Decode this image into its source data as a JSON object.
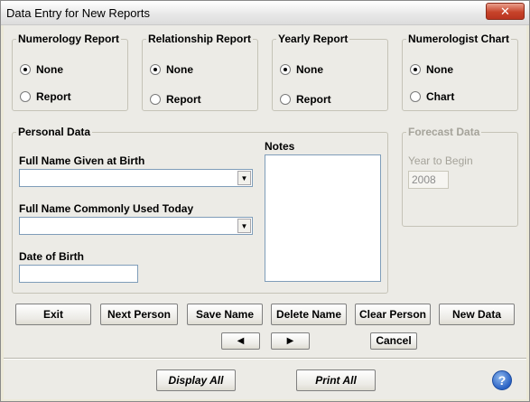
{
  "window": {
    "title": "Data Entry for New Reports",
    "close_glyph": "✕"
  },
  "numerology_report": {
    "label": "Numerology Report",
    "options": [
      "None",
      "Report"
    ],
    "selected": "None"
  },
  "relationship_report": {
    "label": "Relationship Report",
    "options": [
      "None",
      "Report"
    ],
    "selected": "None"
  },
  "yearly_report": {
    "label": "Yearly Report",
    "options": [
      "None",
      "Report"
    ],
    "selected": "None"
  },
  "numerologist_chart": {
    "label": "Numerologist Chart",
    "options": [
      "None",
      "Chart"
    ],
    "selected": "None"
  },
  "personal_data": {
    "label": "Personal Data",
    "full_name_birth_label": "Full Name Given at Birth",
    "full_name_birth_value": "",
    "full_name_common_label": "Full Name Commonly Used Today",
    "full_name_common_value": "",
    "dob_label": "Date of Birth",
    "dob_value": "",
    "notes_label": "Notes",
    "notes_value": ""
  },
  "forecast": {
    "label": "Forecast Data",
    "year_label": "Year to Begin",
    "year_value": "2008"
  },
  "buttons": {
    "exit": "Exit",
    "next_person": "Next Person",
    "save_name": "Save Name",
    "delete_name": "Delete Name",
    "clear_person": "Clear Person",
    "new_data": "New Data",
    "prev_arrow": "◀",
    "next_arrow": "▶",
    "cancel": "Cancel",
    "display_all": "Display All",
    "print_all": "Print All",
    "help": "?"
  },
  "icons": {
    "close": "close-icon",
    "dropdown": "chevron-down-icon",
    "help": "help-icon"
  }
}
